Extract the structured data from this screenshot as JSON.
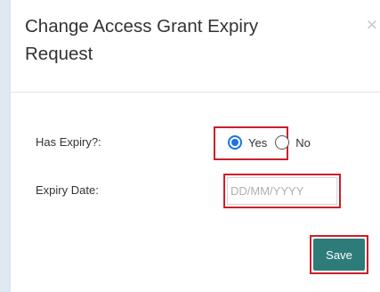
{
  "dialog": {
    "title": "Change Access Grant Expiry Request",
    "close_symbol": "×"
  },
  "form": {
    "has_expiry": {
      "label": "Has Expiry?:",
      "options": [
        {
          "label": "Yes",
          "checked": true
        },
        {
          "label": "No",
          "checked": false
        }
      ]
    },
    "expiry_date": {
      "label": "Expiry Date:",
      "value": "",
      "placeholder": "DD/MM/YYYY"
    }
  },
  "actions": {
    "save_label": "Save"
  },
  "colors": {
    "primary_button": "#2e7c79",
    "highlight_border": "#cc1f2a",
    "radio_accent": "#1a73e8",
    "page_background": "#dfe9f1"
  },
  "icons": {
    "close": "close-icon"
  }
}
